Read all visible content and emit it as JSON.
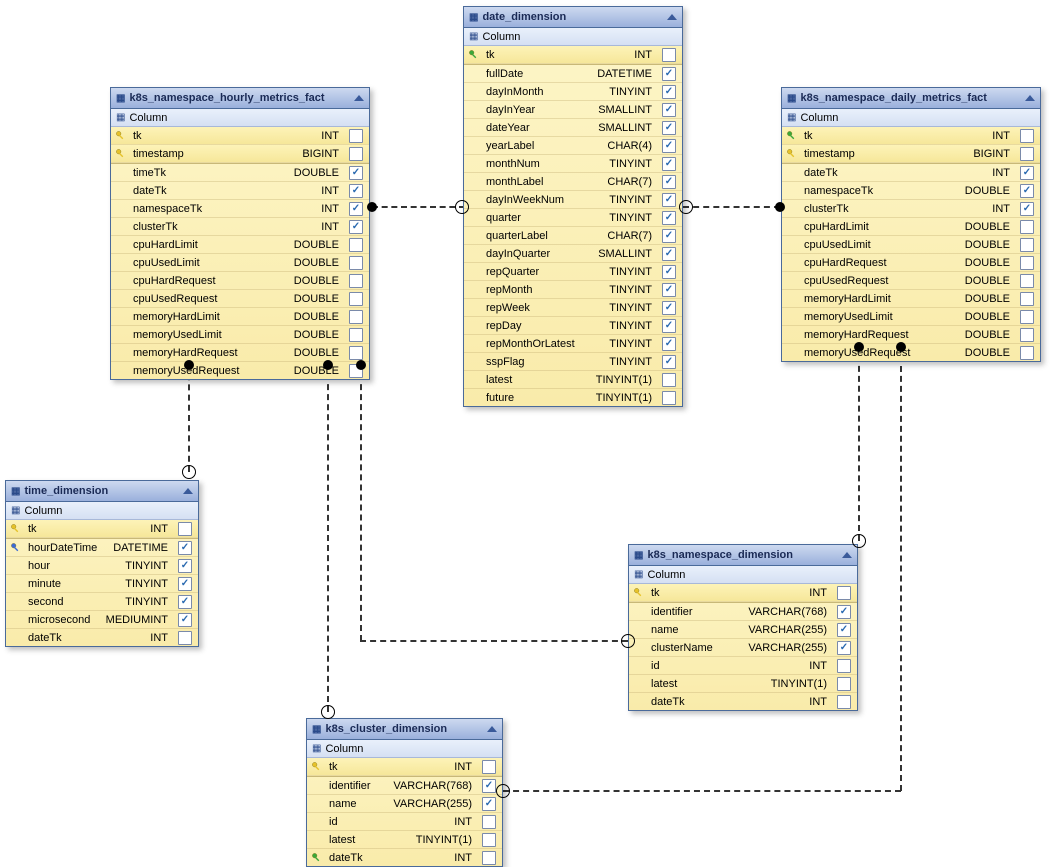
{
  "section_label": "Column",
  "tables": {
    "hourly": {
      "title": "k8s_namespace_hourly_metrics_fact",
      "keys": [
        {
          "name": "tk",
          "type": "INT",
          "kicon": "yellow",
          "checked": false
        },
        {
          "name": "timestamp",
          "type": "BIGINT",
          "kicon": "yellow",
          "checked": false
        }
      ],
      "cols": [
        {
          "name": "timeTk",
          "type": "DOUBLE",
          "checked": true
        },
        {
          "name": "dateTk",
          "type": "INT",
          "checked": true
        },
        {
          "name": "namespaceTk",
          "type": "INT",
          "checked": true
        },
        {
          "name": "clusterTk",
          "type": "INT",
          "checked": true
        },
        {
          "name": "cpuHardLimit",
          "type": "DOUBLE",
          "checked": false
        },
        {
          "name": "cpuUsedLimit",
          "type": "DOUBLE",
          "checked": false
        },
        {
          "name": "cpuHardRequest",
          "type": "DOUBLE",
          "checked": false
        },
        {
          "name": "cpuUsedRequest",
          "type": "DOUBLE",
          "checked": false
        },
        {
          "name": "memoryHardLimit",
          "type": "DOUBLE",
          "checked": false
        },
        {
          "name": "memoryUsedLimit",
          "type": "DOUBLE",
          "checked": false
        },
        {
          "name": "memoryHardRequest",
          "type": "DOUBLE",
          "checked": false
        },
        {
          "name": "memoryUsedRequest",
          "type": "DOUBLE",
          "checked": false
        }
      ]
    },
    "date": {
      "title": "date_dimension",
      "keys": [
        {
          "name": "tk",
          "type": "INT",
          "kicon": "green",
          "checked": false
        }
      ],
      "cols": [
        {
          "name": "fullDate",
          "type": "DATETIME",
          "checked": true
        },
        {
          "name": "dayInMonth",
          "type": "TINYINT",
          "checked": true
        },
        {
          "name": "dayInYear",
          "type": "SMALLINT",
          "checked": true
        },
        {
          "name": "dateYear",
          "type": "SMALLINT",
          "checked": true
        },
        {
          "name": "yearLabel",
          "type": "CHAR(4)",
          "checked": true
        },
        {
          "name": "monthNum",
          "type": "TINYINT",
          "checked": true
        },
        {
          "name": "monthLabel",
          "type": "CHAR(7)",
          "checked": true
        },
        {
          "name": "dayInWeekNum",
          "type": "TINYINT",
          "checked": true
        },
        {
          "name": "quarter",
          "type": "TINYINT",
          "checked": true
        },
        {
          "name": "quarterLabel",
          "type": "CHAR(7)",
          "checked": true
        },
        {
          "name": "dayInQuarter",
          "type": "SMALLINT",
          "checked": true
        },
        {
          "name": "repQuarter",
          "type": "TINYINT",
          "checked": true
        },
        {
          "name": "repMonth",
          "type": "TINYINT",
          "checked": true
        },
        {
          "name": "repWeek",
          "type": "TINYINT",
          "checked": true
        },
        {
          "name": "repDay",
          "type": "TINYINT",
          "checked": true
        },
        {
          "name": "repMonthOrLatest",
          "type": "TINYINT",
          "checked": true
        },
        {
          "name": "sspFlag",
          "type": "TINYINT",
          "checked": true
        },
        {
          "name": "latest",
          "type": "TINYINT(1)",
          "checked": false
        },
        {
          "name": "future",
          "type": "TINYINT(1)",
          "checked": false
        }
      ]
    },
    "daily": {
      "title": "k8s_namespace_daily_metrics_fact",
      "keys": [
        {
          "name": "tk",
          "type": "INT",
          "kicon": "green",
          "checked": false
        },
        {
          "name": "timestamp",
          "type": "BIGINT",
          "kicon": "yellow",
          "checked": false
        }
      ],
      "cols": [
        {
          "name": "dateTk",
          "type": "INT",
          "checked": true
        },
        {
          "name": "namespaceTk",
          "type": "DOUBLE",
          "checked": true
        },
        {
          "name": "clusterTk",
          "type": "INT",
          "checked": true
        },
        {
          "name": "cpuHardLimit",
          "type": "DOUBLE",
          "checked": false
        },
        {
          "name": "cpuUsedLimit",
          "type": "DOUBLE",
          "checked": false
        },
        {
          "name": "cpuHardRequest",
          "type": "DOUBLE",
          "checked": false
        },
        {
          "name": "cpuUsedRequest",
          "type": "DOUBLE",
          "checked": false
        },
        {
          "name": "memoryHardLimit",
          "type": "DOUBLE",
          "checked": false
        },
        {
          "name": "memoryUsedLimit",
          "type": "DOUBLE",
          "checked": false
        },
        {
          "name": "memoryHardRequest",
          "type": "DOUBLE",
          "checked": false
        },
        {
          "name": "memoryUsedRequest",
          "type": "DOUBLE",
          "checked": false
        }
      ]
    },
    "time": {
      "title": "time_dimension",
      "keys": [
        {
          "name": "tk",
          "type": "INT",
          "kicon": "yellow",
          "checked": false
        }
      ],
      "cols": [
        {
          "name": "hourDateTime",
          "type": "DATETIME",
          "kicon": "blue",
          "checked": true
        },
        {
          "name": "hour",
          "type": "TINYINT",
          "checked": true
        },
        {
          "name": "minute",
          "type": "TINYINT",
          "checked": true
        },
        {
          "name": "second",
          "type": "TINYINT",
          "checked": true
        },
        {
          "name": "microsecond",
          "type": "MEDIUMINT",
          "checked": true
        },
        {
          "name": "dateTk",
          "type": "INT",
          "checked": false
        }
      ]
    },
    "namespace": {
      "title": "k8s_namespace_dimension",
      "keys": [
        {
          "name": "tk",
          "type": "INT",
          "kicon": "yellow",
          "checked": false
        }
      ],
      "cols": [
        {
          "name": "identifier",
          "type": "VARCHAR(768)",
          "checked": true
        },
        {
          "name": "name",
          "type": "VARCHAR(255)",
          "checked": true
        },
        {
          "name": "clusterName",
          "type": "VARCHAR(255)",
          "checked": true
        },
        {
          "name": "id",
          "type": "INT",
          "checked": false
        },
        {
          "name": "latest",
          "type": "TINYINT(1)",
          "checked": false
        },
        {
          "name": "dateTk",
          "type": "INT",
          "checked": false
        }
      ]
    },
    "cluster": {
      "title": "k8s_cluster_dimension",
      "keys": [
        {
          "name": "tk",
          "type": "INT",
          "kicon": "yellow",
          "checked": false
        }
      ],
      "cols": [
        {
          "name": "identifier",
          "type": "VARCHAR(768)",
          "checked": true
        },
        {
          "name": "name",
          "type": "VARCHAR(255)",
          "checked": true
        },
        {
          "name": "id",
          "type": "INT",
          "checked": false
        },
        {
          "name": "latest",
          "type": "TINYINT(1)",
          "checked": false
        },
        {
          "name": "dateTk",
          "type": "INT",
          "kicon": "green",
          "checked": false
        }
      ]
    }
  }
}
